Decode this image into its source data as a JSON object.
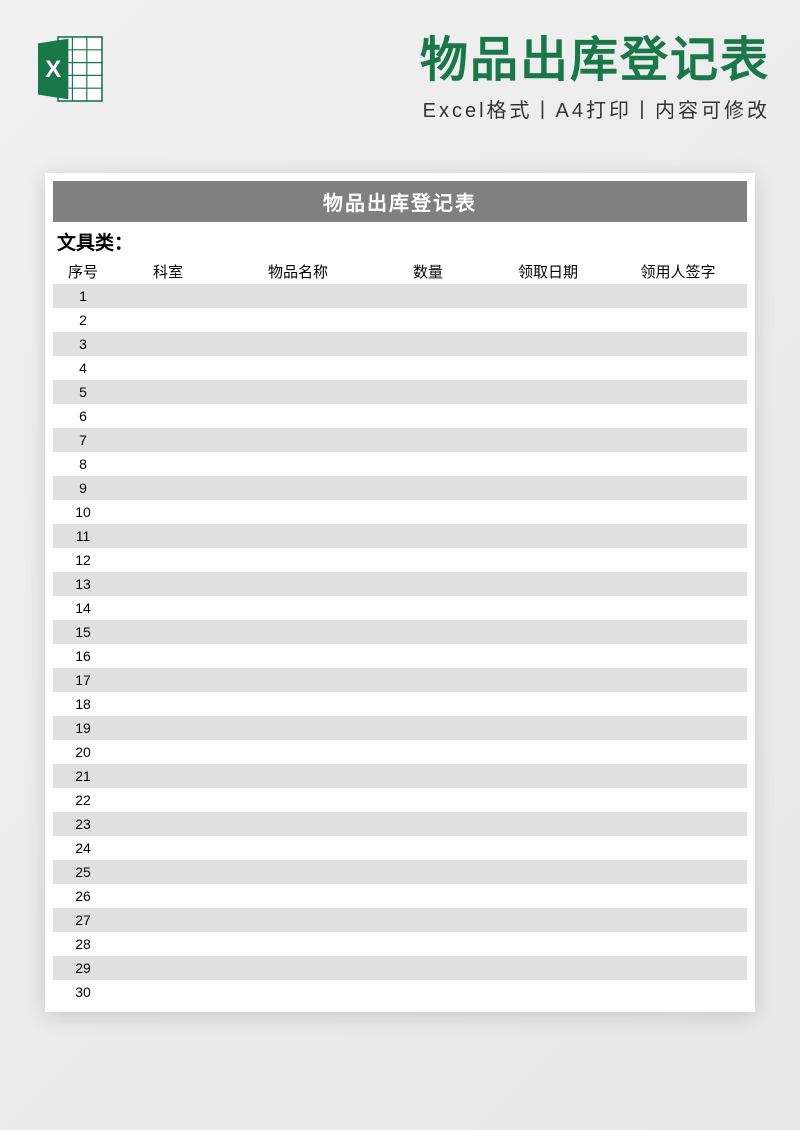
{
  "header": {
    "main_title": "物品出库登记表",
    "subtitle": "Excel格式丨A4打印丨内容可修改"
  },
  "document": {
    "title": "物品出库登记表",
    "category": "文具类：",
    "columns": {
      "seq": "序号",
      "dept": "科室",
      "item": "物品名称",
      "qty": "数量",
      "date": "领取日期",
      "sign": "领用人签字"
    },
    "rows": [
      {
        "num": "1"
      },
      {
        "num": "2"
      },
      {
        "num": "3"
      },
      {
        "num": "4"
      },
      {
        "num": "5"
      },
      {
        "num": "6"
      },
      {
        "num": "7"
      },
      {
        "num": "8"
      },
      {
        "num": "9"
      },
      {
        "num": "10"
      },
      {
        "num": "11"
      },
      {
        "num": "12"
      },
      {
        "num": "13"
      },
      {
        "num": "14"
      },
      {
        "num": "15"
      },
      {
        "num": "16"
      },
      {
        "num": "17"
      },
      {
        "num": "18"
      },
      {
        "num": "19"
      },
      {
        "num": "20"
      },
      {
        "num": "21"
      },
      {
        "num": "22"
      },
      {
        "num": "23"
      },
      {
        "num": "24"
      },
      {
        "num": "25"
      },
      {
        "num": "26"
      },
      {
        "num": "27"
      },
      {
        "num": "28"
      },
      {
        "num": "29"
      },
      {
        "num": "30"
      }
    ]
  }
}
